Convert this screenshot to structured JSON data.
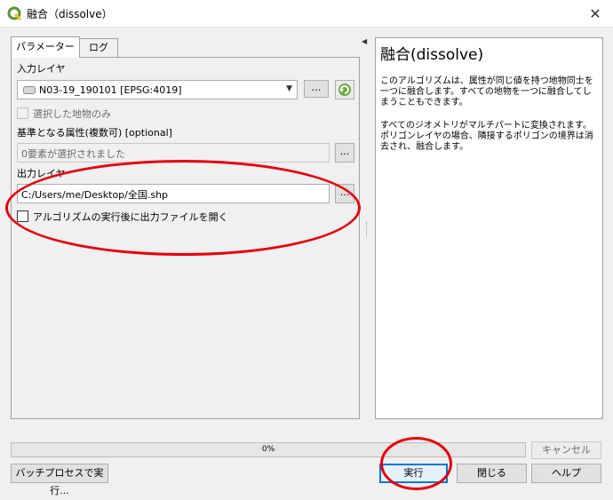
{
  "window": {
    "title": "融合（dissolve）",
    "close_glyph": "✕"
  },
  "tabs": [
    {
      "label": "パラメーター"
    },
    {
      "label": "ログ"
    }
  ],
  "params": {
    "input_layer_label": "入力レイヤ",
    "input_layer_value": "N03-19_190101 [EPSG:4019]",
    "more_button_label": "…",
    "selected_only_label": "選択した地物のみ",
    "dissolve_field_label": "基準となる属性(複数可) [optional]",
    "dissolve_field_value": "0要素が選択されました",
    "dissolve_field_button": "...",
    "output_layer_label": "出力レイヤ",
    "output_layer_value": "C:/Users/me/Desktop/全国.shp",
    "output_button": "...",
    "open_after_label": "アルゴリズムの実行後に出力ファイルを開く"
  },
  "help": {
    "title": "融合(dissolve)",
    "paragraph1": "このアルゴリズムは、属性が同じ値を持つ地物同士を一つに融合します。すべての地物を一つに融合してしまうこともできます。",
    "paragraph2": "すべてのジオメトリがマルチパートに変換されます。ポリゴンレイヤの場合、隣接するポリゴンの境界は消去され、融合します。"
  },
  "progress": {
    "value": 0,
    "label": "0%"
  },
  "buttons": {
    "cancel": "キャンセル",
    "batch": "バッチプロセスで実行...",
    "run": "実行",
    "close": "閉じる",
    "help": "ヘルプ"
  },
  "colors": {
    "accent": "#0078d7",
    "annotation_red": "#e8000b",
    "qgis_green": "#589632"
  },
  "icons": {
    "app": "qgis-logo-icon",
    "layer": "polygon-layer-icon",
    "iterate": "iterate-refresh-icon",
    "collapse": "collapse-arrow-icon"
  }
}
